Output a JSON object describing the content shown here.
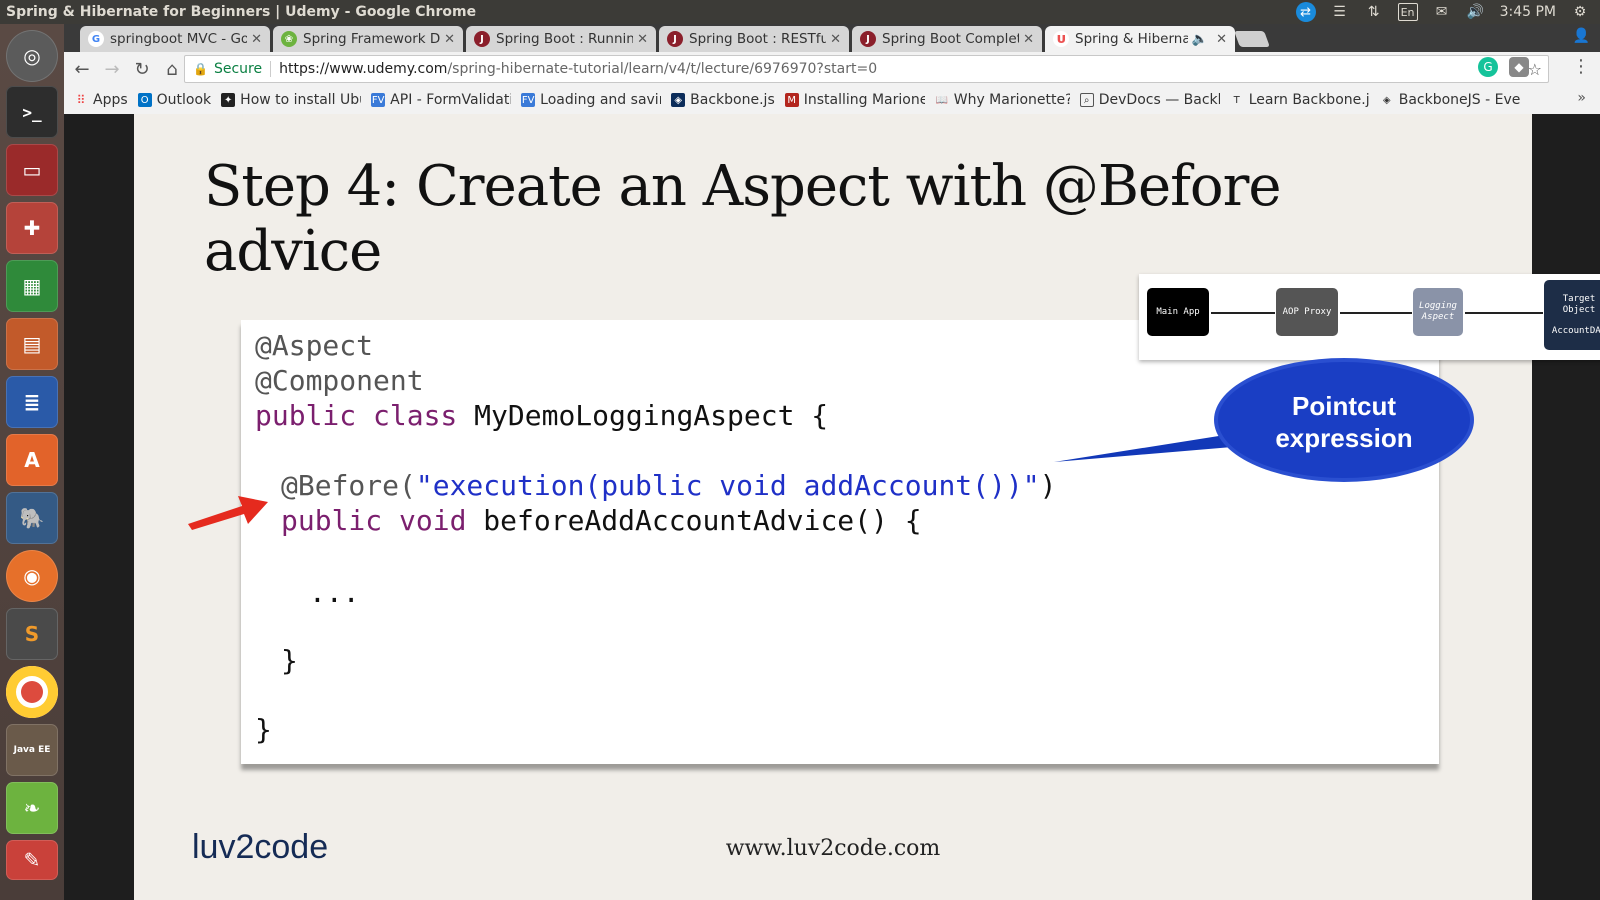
{
  "window": {
    "title": "Spring & Hibernate for Beginners | Udemy - Google Chrome"
  },
  "tray": {
    "language": "En",
    "time": "3:45 PM"
  },
  "tabs": [
    {
      "label": "springboot MVC - Go",
      "icon": "google-icon",
      "color": "#4285f4"
    },
    {
      "label": "Spring Framework D",
      "icon": "spring-icon",
      "color": "#6db33f"
    },
    {
      "label": "Spring Boot : Running",
      "icon": "javabrains-icon",
      "color": "#8b1f2b"
    },
    {
      "label": "Spring Boot : RESTful",
      "icon": "javabrains-icon",
      "color": "#8b1f2b"
    },
    {
      "label": "Spring Boot Complet",
      "icon": "javabrains-icon",
      "color": "#8b1f2b"
    },
    {
      "label": "Spring & Hibernat",
      "icon": "udemy-icon",
      "color": "#ec5252"
    }
  ],
  "omnibox": {
    "secure_label": "Secure",
    "url_host": "https://www.udemy.com",
    "url_path": "/spring-hibernate-tutorial/learn/v4/t/lecture/6976970?start=0"
  },
  "bookmarks": [
    {
      "label": "Apps",
      "icon": "apps-grid-icon"
    },
    {
      "label": "Outlook",
      "icon": "outlook-icon"
    },
    {
      "label": "How to install Ubu",
      "icon": "bookmark-icon"
    },
    {
      "label": "API - FormValidati",
      "icon": "fv-icon"
    },
    {
      "label": "Loading and saving",
      "icon": "fv-icon"
    },
    {
      "label": "Backbone.js",
      "icon": "backbone-icon"
    },
    {
      "label": "Installing Marione",
      "icon": "marionette-icon"
    },
    {
      "label": "Why Marionette?",
      "icon": "book-icon"
    },
    {
      "label": "DevDocs — Backb",
      "icon": "devdocs-icon"
    },
    {
      "label": "Learn Backbone.js",
      "icon": "text-icon"
    },
    {
      "label": "BackboneJS - Ever",
      "icon": "backbone-icon"
    }
  ],
  "slide": {
    "title": "Step 4: Create an Aspect with @Before advice",
    "code": {
      "line1": "@Aspect",
      "line2": "@Component",
      "line3_kw": "public class",
      "line3_rest": " MyDemoLoggingAspect {",
      "line4_ann": "@Before(",
      "line4_str": "\"execution(public void addAccount())\"",
      "line4_close": ")",
      "line5_kw": "public void",
      "line5_rest": " beforeAddAccountAdvice() {",
      "line6": "...",
      "line7": "}",
      "line8": "}"
    },
    "diagram": {
      "main_app": "Main App",
      "aop_proxy": "AOP Proxy",
      "logging_aspect": "Logging Aspect",
      "target_object": "Target Object",
      "account_dao": "AccountDAO"
    },
    "callout": {
      "line1": "Pointcut",
      "line2": "expression"
    },
    "footer": {
      "logo": "luv2code",
      "url": "www.luv2code.com"
    }
  }
}
